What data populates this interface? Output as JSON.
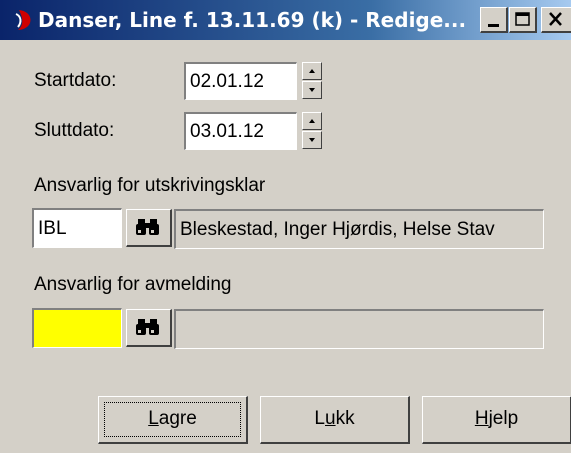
{
  "window": {
    "title": "Danser, Line f. 13.11.69 (k) - Redige..."
  },
  "form": {
    "start_label": "Startdato:",
    "start_value": "02.01.12",
    "end_label": "Sluttdato:",
    "end_value": "03.01.12",
    "discharge_label": "Ansvarlig for utskrivingsklar",
    "discharge_code": "IBL",
    "discharge_name": "Bleskestad, Inger Hjørdis, Helse Stav",
    "deregistration_label": "Ansvarlig for avmelding",
    "deregistration_code": "",
    "deregistration_name": ""
  },
  "buttons": {
    "save": {
      "prefix": "",
      "accel": "L",
      "rest": "agre"
    },
    "close": {
      "prefix": "L",
      "accel": "u",
      "rest": "kk"
    },
    "help": {
      "prefix": "",
      "accel": "H",
      "rest": "jelp"
    }
  },
  "colors": {
    "highlight_field": "#ffff00"
  }
}
